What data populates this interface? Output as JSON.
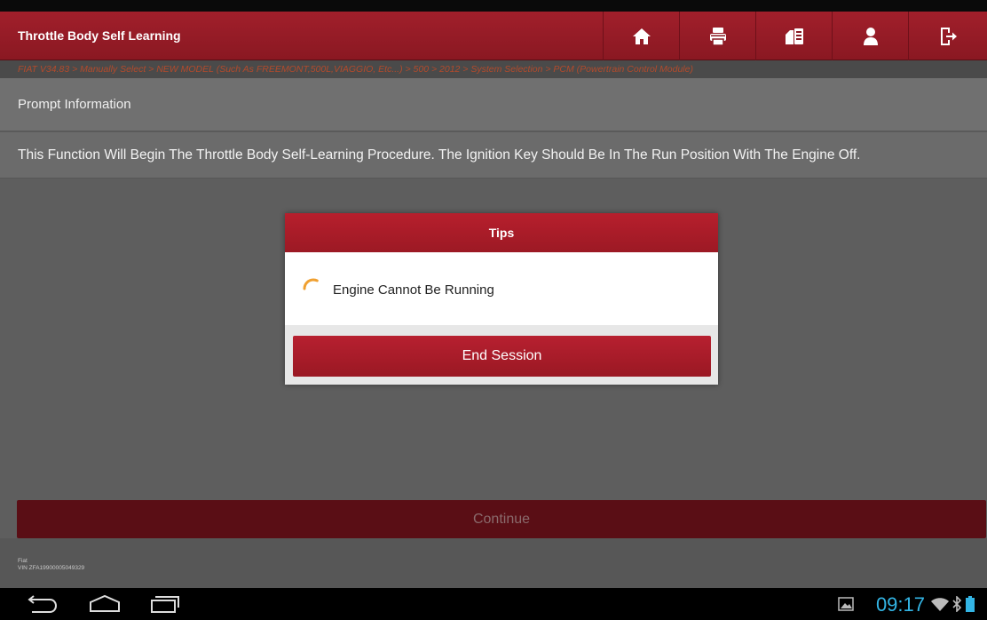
{
  "header": {
    "title": "Throttle Body Self Learning",
    "buttons": [
      {
        "icon": "home-icon"
      },
      {
        "icon": "print-icon"
      },
      {
        "icon": "report-icon"
      },
      {
        "icon": "user-icon"
      },
      {
        "icon": "exit-icon"
      }
    ]
  },
  "breadcrumb": "FIAT V34.83 > Manually Select > NEW MODEL (Such As FREEMONT,500L,VIAGGIO, Etc...) > 500 > 2012 > System Selection > PCM (Powertrain Control Module)",
  "prompt": {
    "header": "Prompt Information",
    "text": "This Function Will Begin The Throttle Body Self-Learning Procedure. The Ignition Key Should Be In The Run Position With The Engine Off."
  },
  "dialog": {
    "title": "Tips",
    "message": "Engine Cannot Be Running",
    "button": "End Session"
  },
  "continue_label": "Continue",
  "vehicle": {
    "make": "Fiat",
    "vin": "VIN ZFA19900005049329"
  },
  "statusbar": {
    "time": "09:17"
  },
  "colors": {
    "brand_red": "#a11f2b",
    "clock_blue": "#33b5e5",
    "spinner_orange": "#f0a030"
  }
}
